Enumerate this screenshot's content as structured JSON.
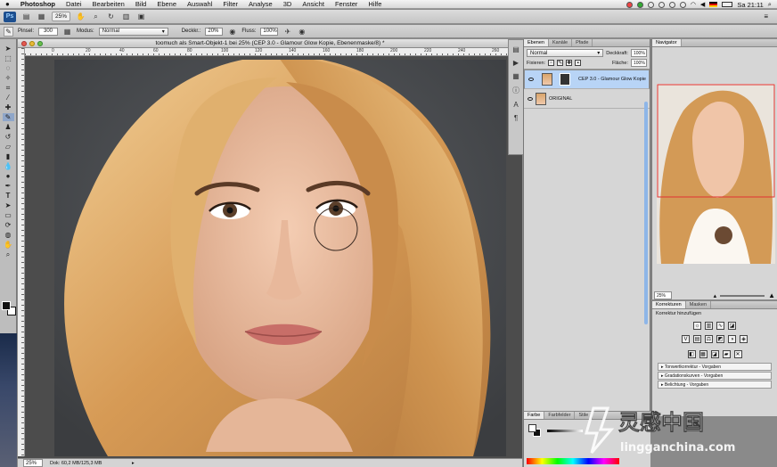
{
  "menubar": {
    "items": [
      "Photoshop",
      "Datei",
      "Bearbeiten",
      "Bild",
      "Ebene",
      "Auswahl",
      "Filter",
      "Analyse",
      "3D",
      "Ansicht",
      "Fenster",
      "Hilfe"
    ],
    "clock": "Sa 21:11"
  },
  "appbar": {
    "logo": "Ps",
    "zoom": "25%",
    "right_icon": "≡"
  },
  "options": {
    "brush_label": "Pinsel:",
    "brush_size": "300",
    "mode_label": "Modus:",
    "mode_value": "Normal",
    "opacity_label": "Deckkr.:",
    "opacity_value": "20%",
    "flow_label": "Fluss:",
    "flow_value": "100%"
  },
  "document": {
    "title": "toomuch als Smart-Objekt-1 bei 25% (CEP 3.0 - Glamour Glow Kopie, Ebenenmaske/8) *",
    "ruler_ticks": [
      "0",
      "20",
      "40",
      "60",
      "80",
      "100",
      "120",
      "140",
      "160",
      "180",
      "200",
      "220",
      "240",
      "260"
    ],
    "status_zoom": "25%",
    "status_doc": "Dok: 60,2 MB/125,3 MB"
  },
  "layers_panel": {
    "tabs": [
      "Ebenen",
      "Kanäle",
      "Pfade"
    ],
    "blend_mode": "Normal",
    "opacity_label": "Deckkraft:",
    "opacity_value": "100%",
    "lock_label": "Fixieren:",
    "fill_label": "Fläche:",
    "fill_value": "100%",
    "layers": [
      {
        "name": "CEP 3.0 - Glamour Glow Kopie",
        "selected": true
      },
      {
        "name": "ORIGINAL",
        "selected": false
      }
    ]
  },
  "navigator": {
    "tab": "Navigator",
    "zoom": "25%"
  },
  "adjustments": {
    "tabs": [
      "Korrekturen",
      "Masken"
    ],
    "header": "Korrektur hinzufügen",
    "presets": [
      "Tonwertkorrektur - Vorgaben",
      "Gradationskurven - Vorgaben",
      "Belichtung - Vorgaben"
    ]
  },
  "color_panel": {
    "tabs": [
      "Farbe",
      "Farbfelder",
      "Stile"
    ]
  },
  "watermark": {
    "cn": "灵感中国",
    "url": "lingganchina.com"
  }
}
